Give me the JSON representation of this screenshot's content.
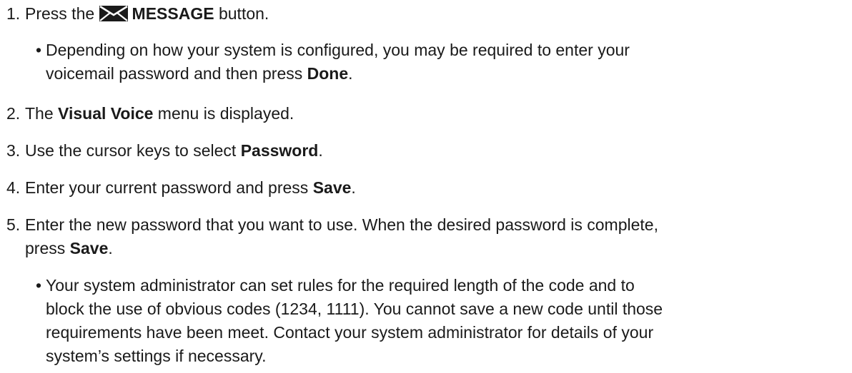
{
  "doc": {
    "s1": {
      "num": "1.",
      "pre": "Press the",
      "icon": "envelope-icon",
      "button": "MESSAGE",
      "post": " button."
    },
    "s1_note": {
      "bullet": "•",
      "l1": "Depending on how your system is configured, you may be required to enter your",
      "l2_pre": "voicemail password and then press ",
      "l2_bold": "Done",
      "l2_post": "."
    },
    "s2": {
      "num": "2.",
      "pre": "The ",
      "bold": "Visual Voice",
      "post": " menu is displayed."
    },
    "s3": {
      "num": "3.",
      "pre": "Use the cursor keys to select ",
      "bold": "Password",
      "post": "."
    },
    "s4": {
      "num": "4.",
      "pre": "Enter your current password and press ",
      "bold": "Save",
      "post": "."
    },
    "s5": {
      "num": "5.",
      "l1": "Enter the new password that you want to use. When the desired password is complete,",
      "l2_pre": "press ",
      "l2_bold": "Save",
      "l2_post": "."
    },
    "s5_note": {
      "bullet": "•",
      "l1": "Your system administrator can set rules for the required length of the code and to",
      "l2": "block the use of obvious codes (1234, 1111). You cannot save a new code until those",
      "l3": "requirements have been meet. Contact your system administrator for details of your",
      "l4": "system’s settings if necessary."
    }
  }
}
